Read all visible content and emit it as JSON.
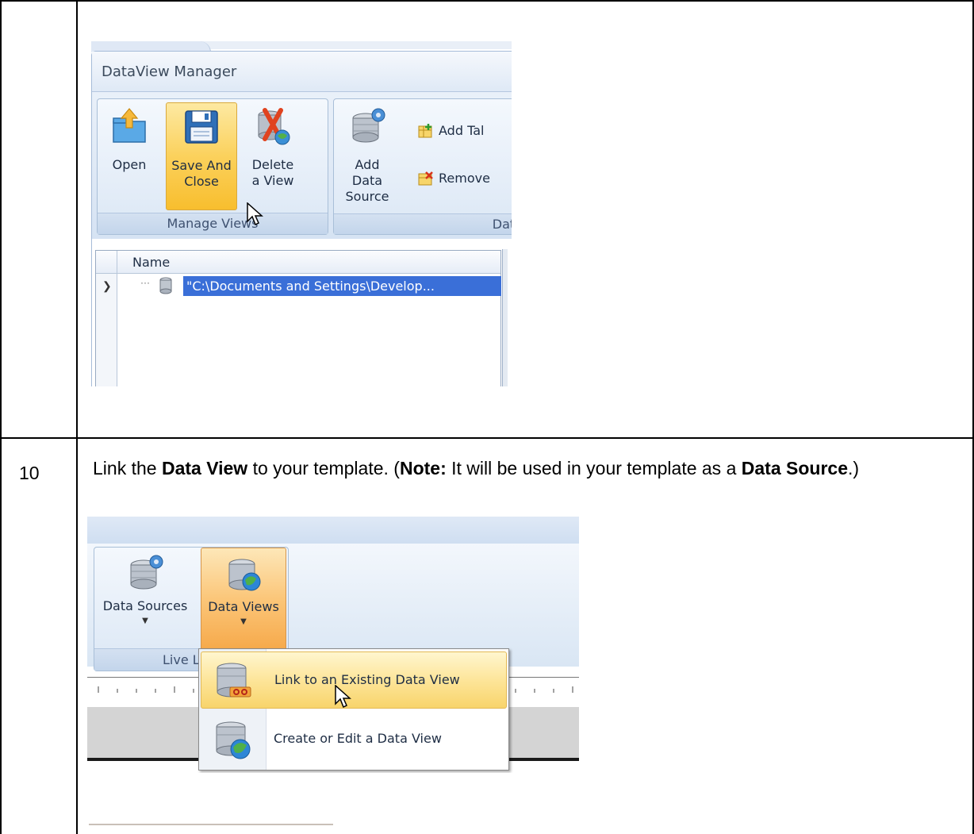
{
  "step": {
    "number": "10",
    "text_parts": [
      {
        "t": "Link the ",
        "b": false
      },
      {
        "t": "Data View",
        "b": true
      },
      {
        "t": " to your template. (",
        "b": false
      },
      {
        "t": "Note:",
        "b": true
      },
      {
        "t": "  It will be used in your template as a ",
        "b": false
      },
      {
        "t": "Data Source",
        "b": true
      },
      {
        "t": ".)",
        "b": false
      }
    ]
  },
  "dataview_manager": {
    "title": "DataView Manager",
    "group_manage_views": {
      "label": "Manage Views",
      "buttons": [
        {
          "label1": "Open",
          "label2": "",
          "icon": "open-folder-icon"
        },
        {
          "label1": "Save And",
          "label2": "Close",
          "icon": "save-disk-icon"
        },
        {
          "label1": "Delete",
          "label2": "a View",
          "icon": "delete-view-icon"
        }
      ]
    },
    "group_data": {
      "label": "Data",
      "add_data_source": {
        "label1": "Add Data",
        "label2": "Source",
        "icon": "database-gear-icon"
      },
      "small_buttons": [
        {
          "label": "Add Tal",
          "icon": "add-table-icon"
        },
        {
          "label": "Remove",
          "icon": "remove-table-icon"
        }
      ]
    },
    "grid": {
      "column": "Name",
      "row_value": "\"C:\\Documents and Settings\\Develop..."
    }
  },
  "live_link_ribbon": {
    "group_label": "Live L",
    "buttons": [
      {
        "label": "Data Sources",
        "icon": "database-gear-icon"
      },
      {
        "label": "Data Views",
        "icon": "database-globe-icon"
      }
    ],
    "menu_items": [
      {
        "label": "Link to an Existing Data View",
        "icon": "database-link-icon"
      },
      {
        "label": "Create or Edit a Data View",
        "icon": "database-globe-icon"
      }
    ]
  },
  "colors": {
    "selection": "#3a6fd8",
    "hover_orange": "#fbd15c",
    "ribbon_blue": "#dbe7f5"
  }
}
